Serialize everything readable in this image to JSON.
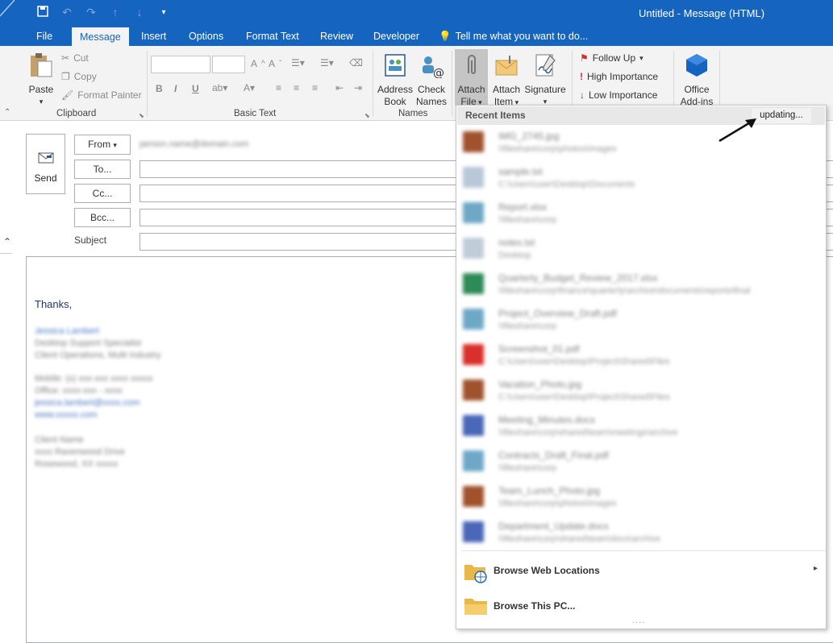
{
  "window": {
    "title": "Untitled - Message (HTML)"
  },
  "tabs": [
    "File",
    "Message",
    "Insert",
    "Options",
    "Format Text",
    "Review",
    "Developer"
  ],
  "tell_me": "Tell me what you want to do...",
  "clipboard": {
    "paste": "Paste",
    "cut": "Cut",
    "copy": "Copy",
    "format_painter": "Format Painter",
    "label": "Clipboard"
  },
  "basic_text": {
    "label": "Basic Text",
    "bold": "B",
    "italic": "I",
    "underline": "U"
  },
  "names": {
    "address_book": [
      "Address",
      "Book"
    ],
    "check_names": [
      "Check",
      "Names"
    ],
    "label": "Names"
  },
  "include": {
    "attach_file": [
      "Attach",
      "File"
    ],
    "attach_item": [
      "Attach",
      "Item"
    ],
    "signature": "Signature"
  },
  "tags": {
    "follow_up": "Follow Up",
    "high": "High Importance",
    "low": "Low Importance"
  },
  "addins": {
    "label": [
      "Office",
      "Add-ins"
    ]
  },
  "compose": {
    "send": "Send",
    "from": "From",
    "to": "To...",
    "cc": "Cc...",
    "bcc": "Bcc...",
    "subject": "Subject",
    "from_value": "person.name@domain.com",
    "greeting": "Thanks,",
    "signature_lines": [
      "Jessica Lambert",
      "Desktop Support Specialist",
      "Client Operations, Multi Industry",
      "Mobile: (x) xxx-xxx xxxx xxxxx",
      "Office: xxxx-xxx - xxxx",
      "jessica.lambert@xxxx.com",
      "www.xxxxx.com",
      "Client Name",
      "xxxx Ravenwood Drive",
      "Rosewood, XX xxxxx"
    ]
  },
  "dropdown": {
    "header": "Recent Items",
    "status": "updating...",
    "items": [
      {
        "name": "IMG_2745.jpg",
        "path": "\\\\fileshare\\corp\\photos\\images",
        "color": "#a0522d"
      },
      {
        "name": "sample.txt",
        "path": "C:\\Users\\user\\Desktop\\Documents",
        "color": "#b9c7d8"
      },
      {
        "name": "Report.xlsx",
        "path": "\\\\fileshare\\corp",
        "color": "#6fa8c7"
      },
      {
        "name": "notes.txt",
        "path": "Desktop",
        "color": "#c0ccd8"
      },
      {
        "name": "Quarterly_Budget_Review_2017.xlsx",
        "path": "\\\\fileshare\\corp\\finance\\quarterly\\archive\\documents\\reports\\final",
        "color": "#2e8b57"
      },
      {
        "name": "Project_Overview_Draft.pdf",
        "path": "\\\\fileshare\\corp",
        "color": "#6fa8c7"
      },
      {
        "name": "Screenshot_01.pdf",
        "path": "C:\\Users\\user\\Desktop\\Project\\Shared\\Files",
        "color": "#d9302c"
      },
      {
        "name": "Vacation_Photo.jpg",
        "path": "C:\\Users\\user\\Desktop\\Project\\Shared\\Files",
        "color": "#a0522d"
      },
      {
        "name": "Meeting_Minutes.docx",
        "path": "\\\\fileshare\\corp\\shared\\team\\meetings\\archive",
        "color": "#4a67b8"
      },
      {
        "name": "Contracts_Draft_Final.pdf",
        "path": "\\\\fileshare\\corp",
        "color": "#6fa8c7"
      },
      {
        "name": "Team_Lunch_Photo.jpg",
        "path": "\\\\fileshare\\corp\\photos\\images",
        "color": "#a0522d"
      },
      {
        "name": "Department_Update.docx",
        "path": "\\\\fileshare\\corp\\shared\\team\\docs\\archive",
        "color": "#4a67b8"
      }
    ],
    "browse_web": "Browse Web Locations",
    "browse_pc": "Browse This PC...",
    "more": "...."
  }
}
